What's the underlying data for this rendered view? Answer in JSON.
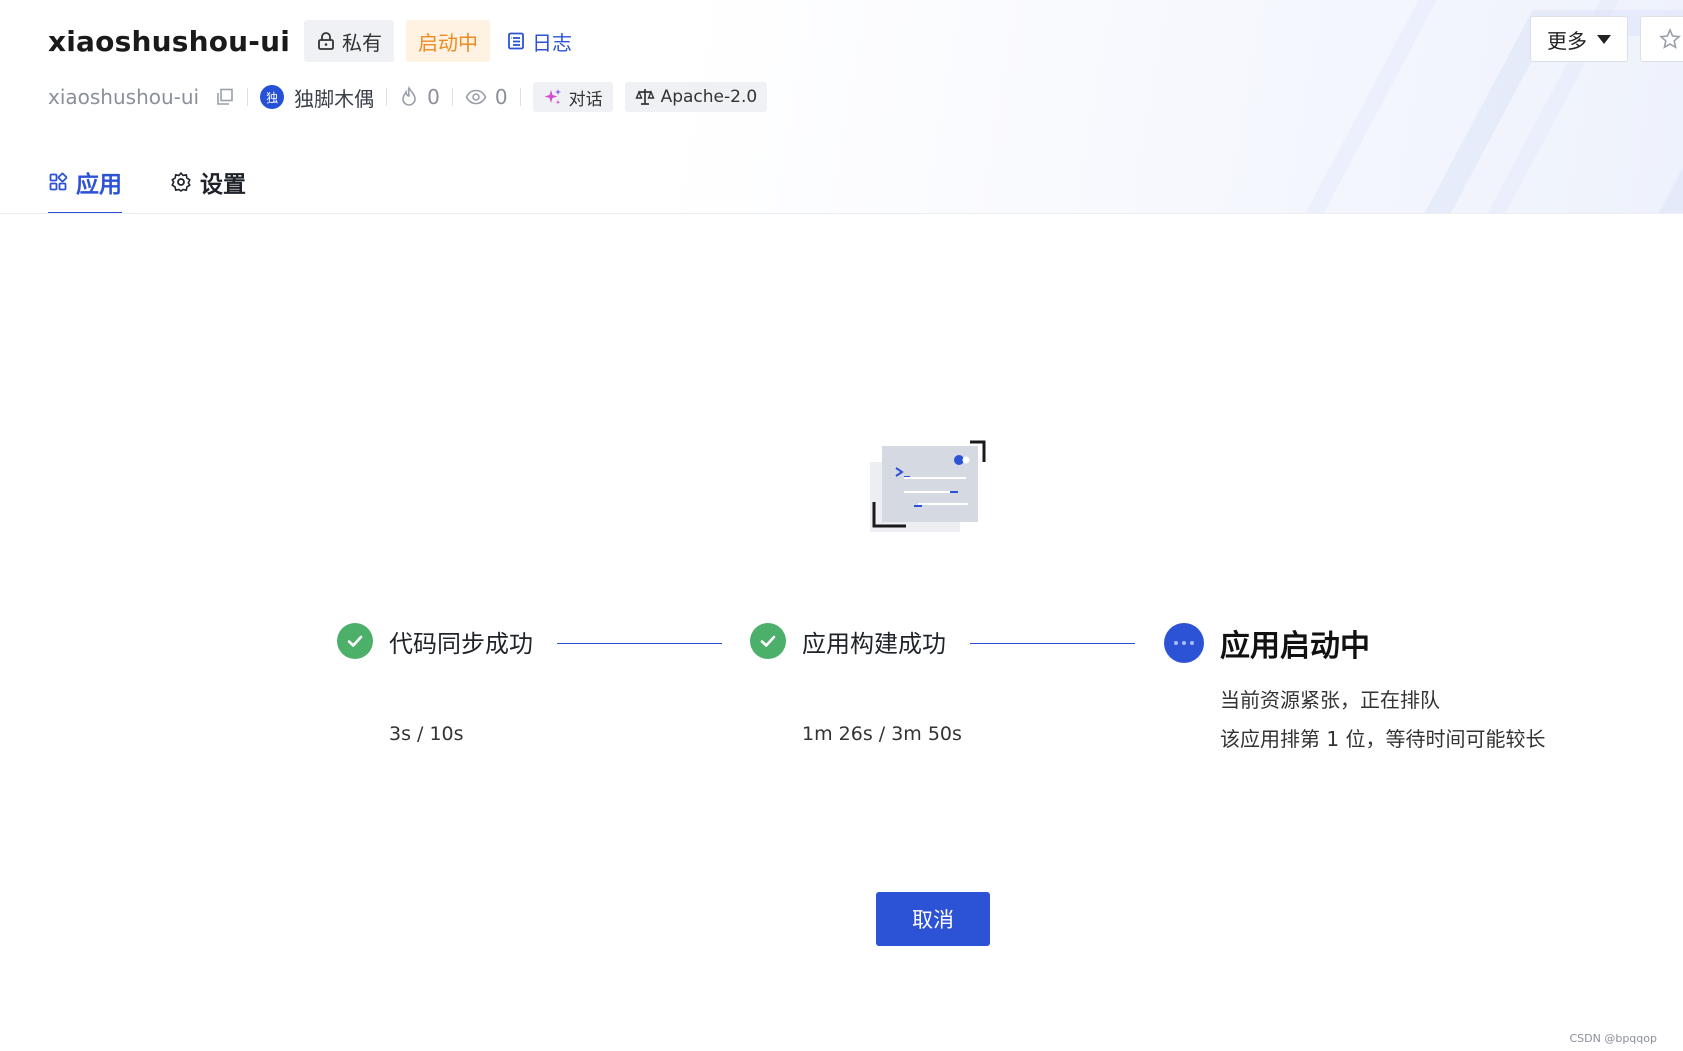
{
  "header": {
    "app_title": "xiaoshushou-ui",
    "tag_private": "私有",
    "tag_status": "启动中",
    "log_label": "日志",
    "repo_name": "xiaoshushou-ui",
    "owner_avatar_char": "独",
    "owner_name": "独脚木偶",
    "likes": "0",
    "views": "0",
    "chat_label": "对话",
    "license": "Apache-2.0",
    "more_label": "更多"
  },
  "tabs": [
    {
      "label": "应用",
      "active": true,
      "icon": "grid-icon"
    },
    {
      "label": "设置",
      "active": false,
      "icon": "gear-icon"
    }
  ],
  "steps": [
    {
      "label": "代码同步成功",
      "time": "3s / 10s",
      "status": "done"
    },
    {
      "label": "应用构建成功",
      "time": "1m 26s / 3m 50s",
      "status": "done"
    },
    {
      "label": "应用启动中",
      "status": "in-progress",
      "desc_line1": "当前资源紧张，正在排队",
      "desc_line2": "该应用排第 1 位，等待时间可能较长"
    }
  ],
  "cancel_label": "取消",
  "watermark": "CSDN @bpqqop",
  "colors": {
    "accent": "#2c52d6",
    "success": "#4caf6a",
    "warning": "#ef8a21"
  }
}
